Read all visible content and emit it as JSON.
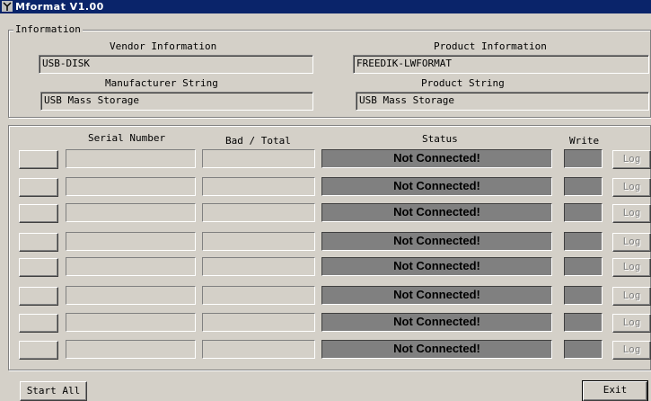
{
  "window": {
    "title": "Mformat V1.00"
  },
  "info": {
    "legend": "Information",
    "vendor_label": "Vendor Information",
    "vendor_value": "USB-DISK",
    "product_label": "Product Information",
    "product_value": "FREEDIK-LWFORMAT",
    "manufacturer_label": "Manufacturer String",
    "manufacturer_value": "USB Mass Storage",
    "product_string_label": "Product String",
    "product_string_value": "USB Mass Storage"
  },
  "ports": {
    "headers": {
      "serial": "Serial Number",
      "bad": "Bad / Total",
      "status": "Status",
      "write": "Write"
    },
    "rows": [
      {
        "status": "Not Connected!",
        "log": "Log"
      },
      {
        "status": "Not Connected!",
        "log": "Log"
      },
      {
        "status": "Not Connected!",
        "log": "Log"
      },
      {
        "status": "Not Connected!",
        "log": "Log"
      },
      {
        "status": "Not Connected!",
        "log": "Log"
      },
      {
        "status": "Not Connected!",
        "log": "Log"
      },
      {
        "status": "Not Connected!",
        "log": "Log"
      },
      {
        "status": "Not Connected!",
        "log": "Log"
      }
    ]
  },
  "footer": {
    "start_all": "Start All",
    "exit": "Exit"
  },
  "icons": {
    "app": "tool-icon"
  }
}
